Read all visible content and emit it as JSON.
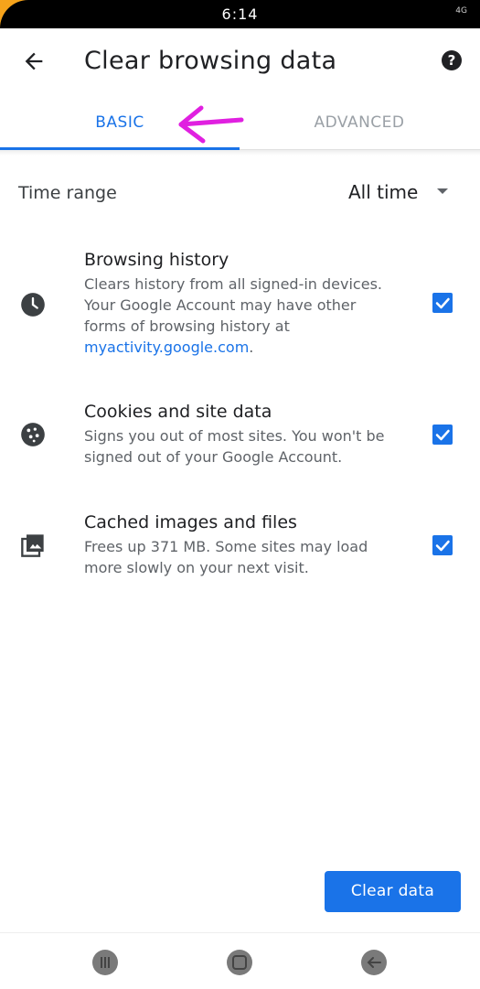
{
  "status_bar": {
    "time": "6:14",
    "signal": "4G"
  },
  "app_bar": {
    "title": "Clear browsing data",
    "back_icon": "arrow-back-icon",
    "help_icon": "help-icon",
    "help_glyph": "?"
  },
  "tabs": [
    {
      "label": "BASIC",
      "selected": true
    },
    {
      "label": "ADVANCED",
      "selected": false
    }
  ],
  "time_range": {
    "label": "Time range",
    "value": "All time"
  },
  "items": [
    {
      "title": "Browsing history",
      "desc_before": "Clears history from all signed-in devices. Your Google Account may have other forms of browsing history at ",
      "link": "myactivity.google.com",
      "desc_after": ".",
      "checked": true,
      "icon": "clock-icon"
    },
    {
      "title": "Cookies and site data",
      "desc": "Signs you out of most sites. You won't be signed out of your Google Account.",
      "checked": true,
      "icon": "cookie-icon"
    },
    {
      "title": "Cached images and files",
      "desc": "Frees up 371 MB. Some sites may load more slowly on your next visit.",
      "checked": true,
      "icon": "image-icon"
    }
  ],
  "button": {
    "label": "Clear data"
  },
  "colors": {
    "accent": "#1a73e8",
    "annotation_arrow": "#e020e0"
  }
}
